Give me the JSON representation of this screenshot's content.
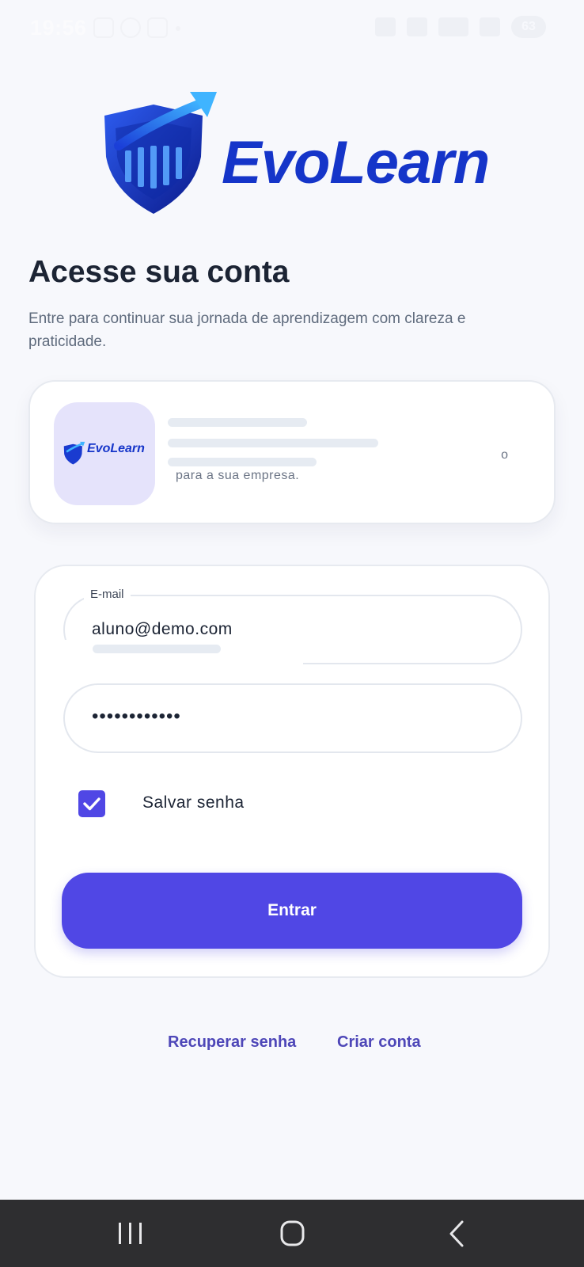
{
  "status_bar": {
    "time": "19:56",
    "battery": "63"
  },
  "brand": {
    "name": "EvoLearn",
    "colors": {
      "primary": "#5047e5",
      "logo_blue": "#1535c9",
      "link": "#4e47b8"
    }
  },
  "header": {
    "title": "Acesse sua conta",
    "subtitle": "Entre para continuar sua jornada de aprendizagem com clareza e praticidade."
  },
  "promo": {
    "thumb_brand": "EvoLearn",
    "text": "para a sua empresa.",
    "trailing": "o"
  },
  "form": {
    "email": {
      "label": "E-mail",
      "value": "aluno@demo.com"
    },
    "password": {
      "value": "••••••••••••"
    },
    "remember": {
      "label": "Salvar senha",
      "checked": true
    },
    "submit_label": "Entrar"
  },
  "links": {
    "recover": "Recuperar senha",
    "create": "Criar conta"
  },
  "nav": {
    "icons": [
      "recent-apps-icon",
      "home-icon",
      "back-icon"
    ]
  }
}
